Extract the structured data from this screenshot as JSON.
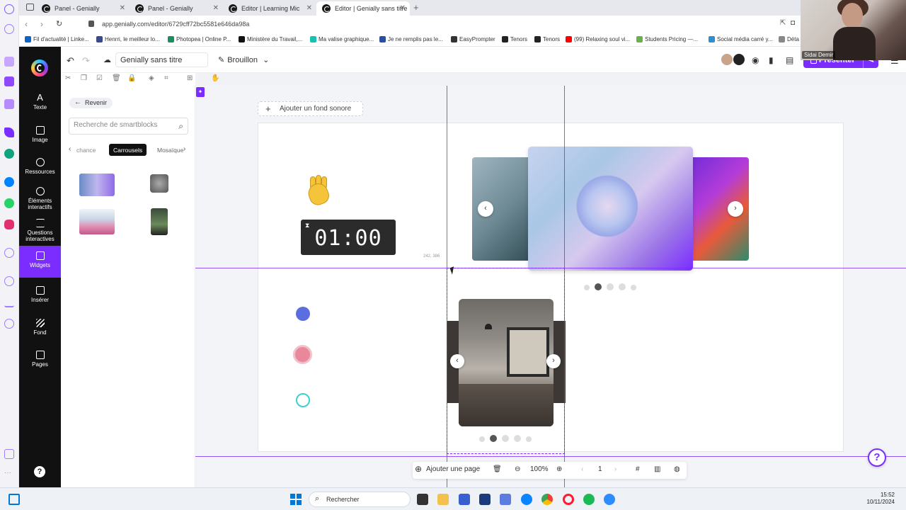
{
  "browser": {
    "tabs": [
      {
        "label": "Panel - Genially"
      },
      {
        "label": "Panel - Genially"
      },
      {
        "label": "Editor | Learning Micro-Co"
      },
      {
        "label": "Editor | Genially sans titre"
      }
    ],
    "url": "app.genially.com/editor/6729cff72bc5581e646da98a",
    "bookmarks": [
      {
        "label": "Fil d'actualité | Linke...",
        "color": "#0a66c2"
      },
      {
        "label": "Henrri, le meilleur lo...",
        "color": "#3b4a8a"
      },
      {
        "label": "Photopea | Online P...",
        "color": "#1c8d5e"
      },
      {
        "label": "Ministère du Travail,...",
        "color": "#111111"
      },
      {
        "label": "Ma valise graphique...",
        "color": "#19c2b0"
      },
      {
        "label": "Je ne remplis pas le...",
        "color": "#2b4fa0"
      },
      {
        "label": "EasyPrompter",
        "color": "#333333"
      },
      {
        "label": "Tenors",
        "color": "#222222"
      },
      {
        "label": "Tenors",
        "color": "#222222"
      },
      {
        "label": "(99) Relaxing soul vi...",
        "color": "#ff0000"
      },
      {
        "label": "Students Pricing —...",
        "color": "#6ab04c"
      },
      {
        "label": "Social média carré y...",
        "color": "#2b8fd0"
      },
      {
        "label": "Déta",
        "color": "#888888"
      }
    ]
  },
  "webcam": {
    "name": "Sidai Demir"
  },
  "rail": {
    "items": [
      {
        "label": "Texte"
      },
      {
        "label": "Image"
      },
      {
        "label": "Ressources"
      },
      {
        "label": "Éléments interactifs"
      },
      {
        "label": "Questions interactives"
      },
      {
        "label": "Widgets"
      },
      {
        "label": "Insérer"
      },
      {
        "label": "Fond"
      },
      {
        "label": "Pages"
      }
    ],
    "help": "?"
  },
  "topbar": {
    "title": "Genially sans titre",
    "status": "Brouillon",
    "present_label": "Présenter"
  },
  "panel": {
    "back_label": "Revenir",
    "search_placeholder": "Recherche de smartblocks",
    "categories": [
      "chance",
      "Carrousels",
      "Mosaïque"
    ],
    "active_category": "Carrousels"
  },
  "canvas": {
    "sound_label": "Ajouter un fond sonore",
    "timer": "01:00",
    "coords": "242, 386"
  },
  "bottombar": {
    "add_page": "Ajouter une page",
    "zoom": "100%",
    "page": "1"
  },
  "taskbar": {
    "search_label": "Rechercher",
    "time": "15:52",
    "date": "10/11/2024"
  },
  "colors": {
    "accent": "#7b2cff",
    "rail_bg": "#111111"
  }
}
